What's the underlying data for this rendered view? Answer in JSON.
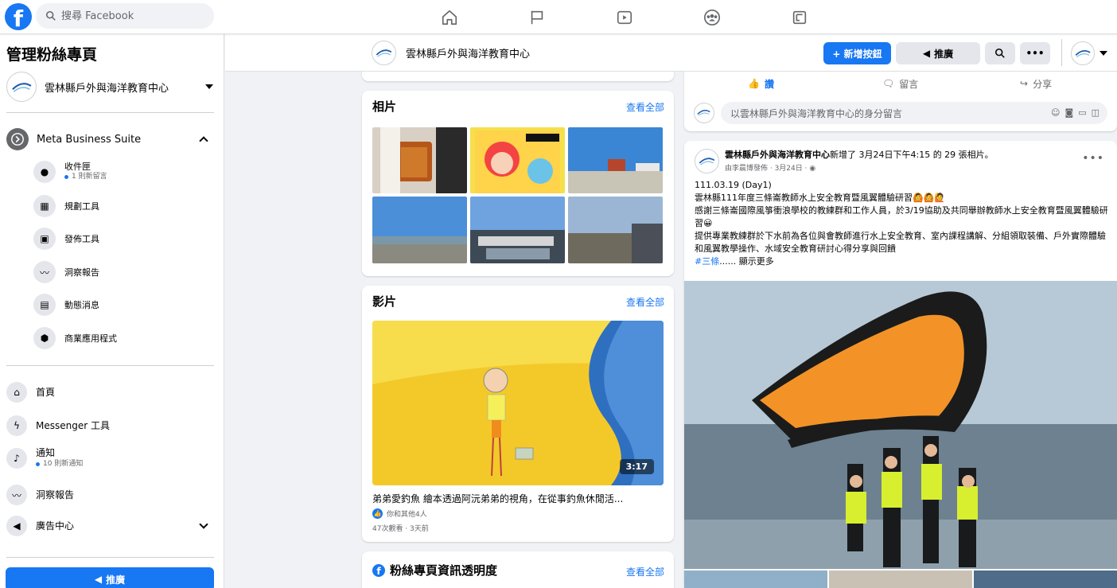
{
  "top_nav": {
    "logo": "f",
    "search_placeholder": "搜尋 Facebook",
    "icons": [
      "home-icon",
      "flag-icon",
      "watch-icon",
      "groups-icon",
      "gaming-icon"
    ]
  },
  "sidebar": {
    "title": "管理粉絲專頁",
    "page_name": "雲林縣戶外與海洋教育中心",
    "business_suite": {
      "label": "Meta Business Suite",
      "items": [
        {
          "label": "收件匣",
          "sub": "1 則新留言",
          "icon": "chat-icon"
        },
        {
          "label": "規劃工具",
          "icon": "calendar-icon"
        },
        {
          "label": "發佈工具",
          "icon": "publish-icon"
        },
        {
          "label": "洞察報告",
          "icon": "insights-icon"
        },
        {
          "label": "動態消息",
          "icon": "news-feed-icon"
        },
        {
          "label": "商業應用程式",
          "icon": "apps-icon"
        }
      ]
    },
    "items": [
      {
        "label": "首頁",
        "icon": "home-icon"
      },
      {
        "label": "Messenger 工具",
        "icon": "messenger-icon"
      },
      {
        "label": "通知",
        "sub": "10 則新通知",
        "icon": "bell-icon"
      },
      {
        "label": "洞察報告",
        "icon": "insights-icon"
      },
      {
        "label": "廣告中心",
        "icon": "megaphone-icon"
      }
    ],
    "promote_label": "推廣"
  },
  "page_bar": {
    "page_name": "雲林縣戶外與海洋教育中心",
    "add_button": "+ 新增按鈕",
    "promote_button": "推廣"
  },
  "photos_card": {
    "title": "相片",
    "see_all": "查看全部"
  },
  "videos_card": {
    "title": "影片",
    "see_all": "查看全部",
    "duration": "3:17",
    "video_title": "弟弟愛釣魚 繪本透過阿沅弟弟的視角，在從事釣魚休閒活...",
    "likes": "你和其他4人",
    "views": "47次觀看 · 3天前"
  },
  "transparency_card": {
    "title": "粉絲專頁資訊透明度",
    "see_all": "查看全部"
  },
  "post_actions": {
    "like": "讚",
    "comment": "留言",
    "share": "分享",
    "comment_placeholder": "以雲林縣戶外與海洋教育中心的身分留言"
  },
  "post": {
    "author": "雲林縣戶外與海洋教育中心",
    "action_text": "新增了 3月24日下午4:15 的 29 張相片。",
    "meta": "由李晨博發佈 · 3月24日 ·",
    "text_lines": [
      "111.03.19 (Day1)",
      "雲林縣111年度三條崙教師水上安全教育暨風翼體驗研習🙆🙆🙋",
      "感謝三條崙國際風箏衝浪學校的教練群和工作人員，於3/19協助及共同舉辦教師水上安全教育暨風翼體驗研習😀",
      "提供專業教練群於下水前為各位與會教師進行水上安全教育、室內課程講解、分組領取裝備、戶外實際體驗和風翼教學操作、水域安全教育研討心得分享與回饋"
    ],
    "hashtag": "#三條",
    "see_more": "...... 顯示更多"
  },
  "colors": {
    "accent": "#1877f2",
    "background": "#f0f2f5"
  }
}
